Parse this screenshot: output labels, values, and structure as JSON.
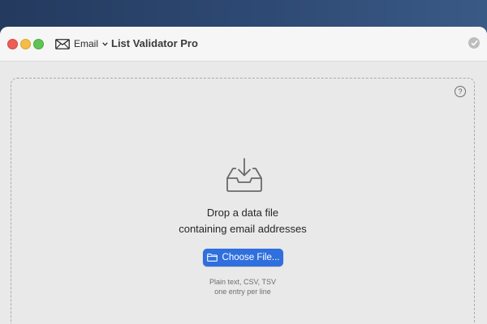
{
  "app": {
    "title": "List Validator Pro",
    "mode_label": "Email"
  },
  "dropzone": {
    "title_line1": "Drop a data file",
    "title_line2": "containing email addresses",
    "button_label": "Choose File...",
    "hint_line1": "Plain text, CSV, TSV",
    "hint_line2": "one entry per line",
    "help_label": "?"
  },
  "icons": {
    "mode": "envelope-icon",
    "mode_dropdown": "chevron-down-icon",
    "status": "checkmark-circle-icon",
    "dropzone": "inbox-tray-download-icon",
    "button": "folder-icon",
    "help": "question-mark-circle-icon"
  },
  "colors": {
    "accent": "#2f6fde",
    "close": "#ee5d57",
    "minimize": "#f4bd45",
    "maximize": "#5fc454",
    "desktop": "#2e4a74"
  }
}
